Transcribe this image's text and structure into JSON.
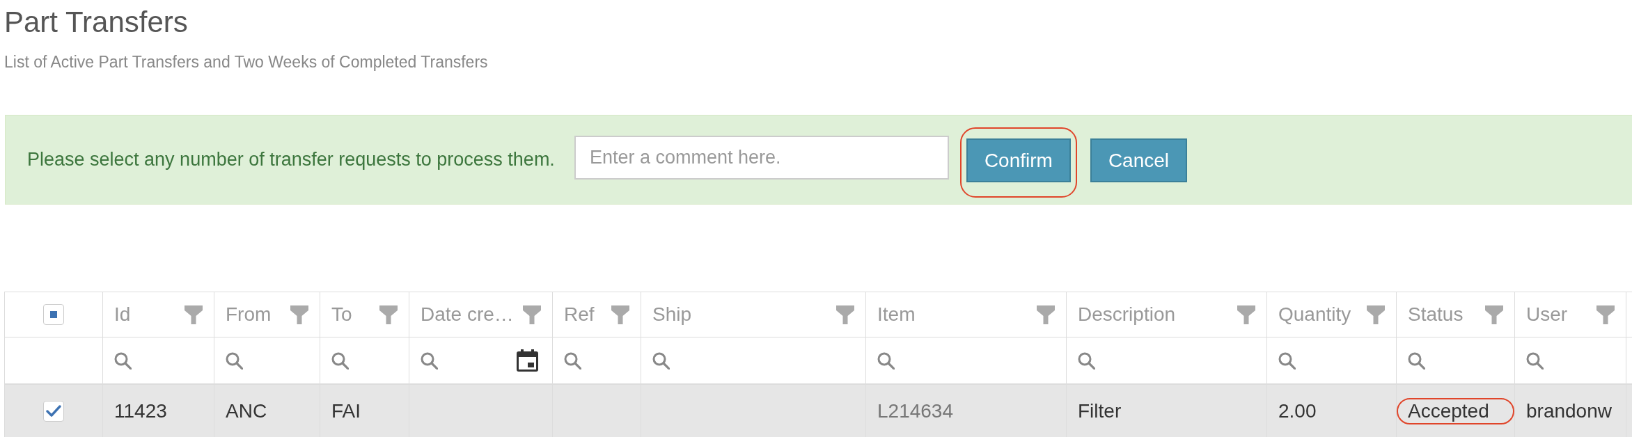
{
  "page": {
    "title": "Part Transfers",
    "subtitle": "List of Active Part Transfers and Two Weeks of Completed Transfers"
  },
  "alert": {
    "message": "Please select any number of transfer requests to process them.",
    "comment_field": {
      "placeholder": "Enter a comment here."
    },
    "buttons": [
      {
        "label": "Confirm",
        "highlighted": true
      },
      {
        "label": "Cancel",
        "highlighted": false
      }
    ]
  },
  "table": {
    "header_checkbox": {
      "indeterminate": true
    },
    "columns": [
      {
        "label": "Id",
        "date_picker": false
      },
      {
        "label": "From",
        "date_picker": false
      },
      {
        "label": "To",
        "date_picker": false
      },
      {
        "label": "Date cre…",
        "date_picker": true
      },
      {
        "label": "Ref",
        "date_picker": false
      },
      {
        "label": "Ship",
        "date_picker": false
      },
      {
        "label": "Item",
        "date_picker": false
      },
      {
        "label": "Description",
        "date_picker": false
      },
      {
        "label": "Quantity",
        "date_picker": false
      },
      {
        "label": "Status",
        "date_picker": false
      },
      {
        "label": "User",
        "date_picker": false
      }
    ],
    "rows": [
      {
        "selected": true,
        "checked": true,
        "cells": [
          {
            "text": "11423",
            "kind": "text",
            "highlighted": false
          },
          {
            "text": "ANC",
            "kind": "text",
            "highlighted": false
          },
          {
            "text": "FAI",
            "kind": "text",
            "highlighted": false
          },
          null,
          null,
          null,
          {
            "text": "L214634",
            "kind": "link",
            "highlighted": false
          },
          {
            "text": "Filter",
            "kind": "text",
            "highlighted": false
          },
          {
            "text": "2.00",
            "kind": "text",
            "highlighted": false
          },
          {
            "text": "Accepted",
            "kind": "text",
            "highlighted": true
          },
          {
            "text": "brandonw",
            "kind": "text",
            "highlighted": false
          }
        ]
      }
    ]
  }
}
